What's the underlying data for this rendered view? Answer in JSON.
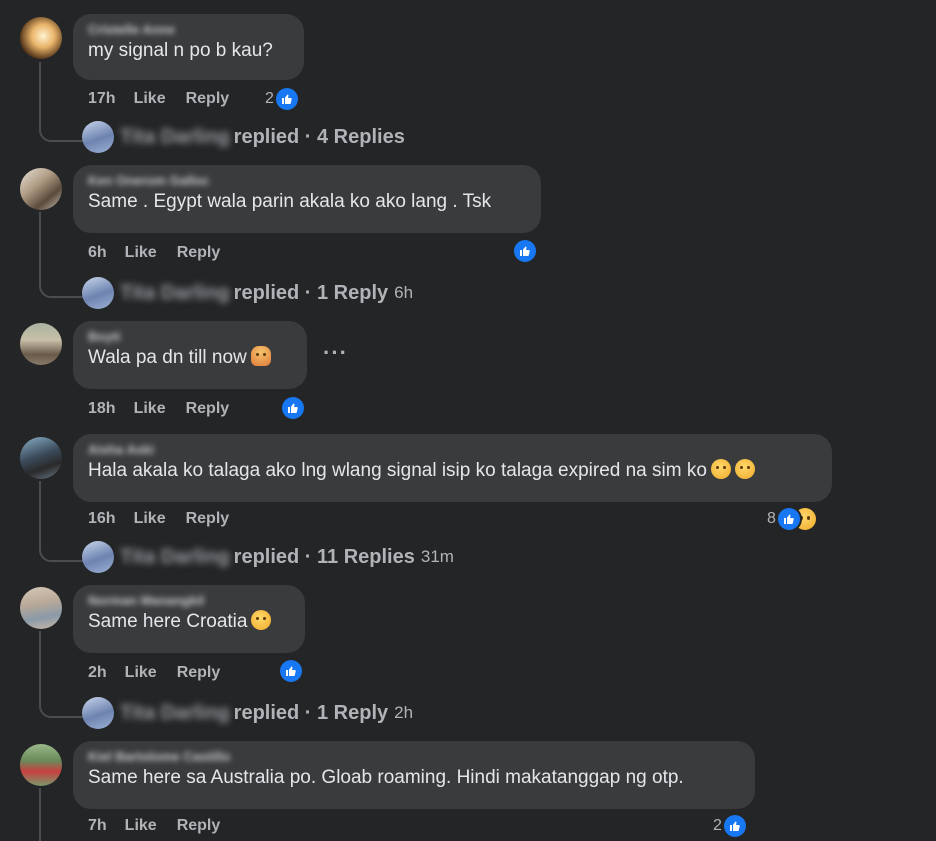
{
  "comments": [
    {
      "name": "Cristelle Anne",
      "text": "my signal n po b kau?",
      "time": "17h",
      "like": "Like",
      "reply": "Reply",
      "reaction_count": "2",
      "replier": "Tita Darling",
      "replied": "replied · 4 Replies",
      "reply_time": ""
    },
    {
      "name": "Ken Onerom Galloc",
      "text": "Same . Egypt wala parin akala ko ako lang . Tsk",
      "time": "6h",
      "like": "Like",
      "reply": "Reply",
      "reaction_count": "",
      "replier": "Tita Darling",
      "replied": "replied · 1 Reply",
      "reply_time": "6h"
    },
    {
      "name": "Boyti",
      "text": "Wala pa dn till now",
      "time": "18h",
      "like": "Like",
      "reply": "Reply",
      "reaction_count": ""
    },
    {
      "name": "Aisha Aski",
      "text": "Hala akala ko talaga ako lng wlang signal isip ko talaga expired na sim ko",
      "time": "16h",
      "like": "Like",
      "reply": "Reply",
      "reaction_count": "8",
      "replier": "Tita Darling",
      "replied": "replied · 11 Replies",
      "reply_time": "31m"
    },
    {
      "name": "Norman Manangkil",
      "text": "Same here Croatia",
      "time": "2h",
      "like": "Like",
      "reply": "Reply",
      "reaction_count": "",
      "replier": "Tita Darling",
      "replied": "replied · 1 Reply",
      "reply_time": "2h"
    },
    {
      "name": "Kiel Bartolome Castillo",
      "text": "Same here sa Australia po. Gloab roaming. Hindi makatanggap ng otp.",
      "time": "7h",
      "like": "Like",
      "reply": "Reply",
      "reaction_count": "2"
    }
  ],
  "more_options": "···",
  "colors": {
    "accent": "#1877f2",
    "bubble": "#3a3b3c",
    "background": "#242526"
  },
  "icons": [
    "like-icon",
    "sad-icon",
    "more-options-icon"
  ]
}
